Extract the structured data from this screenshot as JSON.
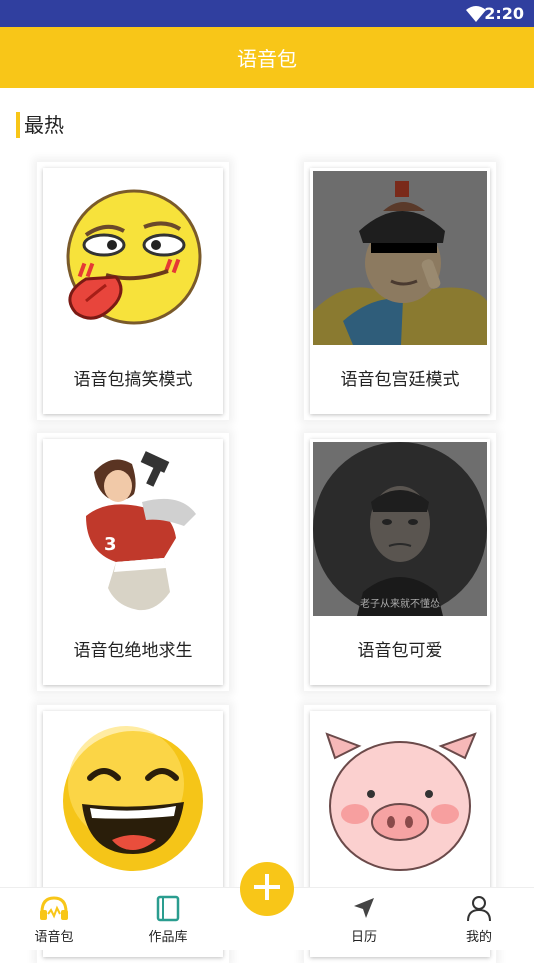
{
  "status_bar": {
    "time": "2:20"
  },
  "app_bar": {
    "title": "语音包"
  },
  "section": {
    "title": "最热"
  },
  "cards": [
    {
      "label": "语音包搞笑模式",
      "image": "funny-emoji-tongue"
    },
    {
      "label": "语音包宫廷模式",
      "image": "qing-official-sunglasses"
    },
    {
      "label": "语音包绝地求生",
      "image": "game-character-girl"
    },
    {
      "label": "语音包可爱",
      "image": "man-portrait-meme",
      "caption": "老子从来就不懂怂"
    },
    {
      "label": "",
      "image": "laughing-emoji"
    },
    {
      "label": "",
      "image": "cute-pig"
    }
  ],
  "bottom_nav": {
    "items": [
      {
        "label": "语音包",
        "icon": "headphones-icon"
      },
      {
        "label": "作品库",
        "icon": "book-icon"
      },
      {
        "label": "日历",
        "icon": "navigation-arrow-icon"
      },
      {
        "label": "我的",
        "icon": "person-icon"
      }
    ],
    "fab_icon": "plus-icon"
  },
  "colors": {
    "accent": "#f8c618",
    "status_bar": "#303f9f",
    "nav_active": "#f8c618",
    "nav_book": "#2a9d8f"
  }
}
